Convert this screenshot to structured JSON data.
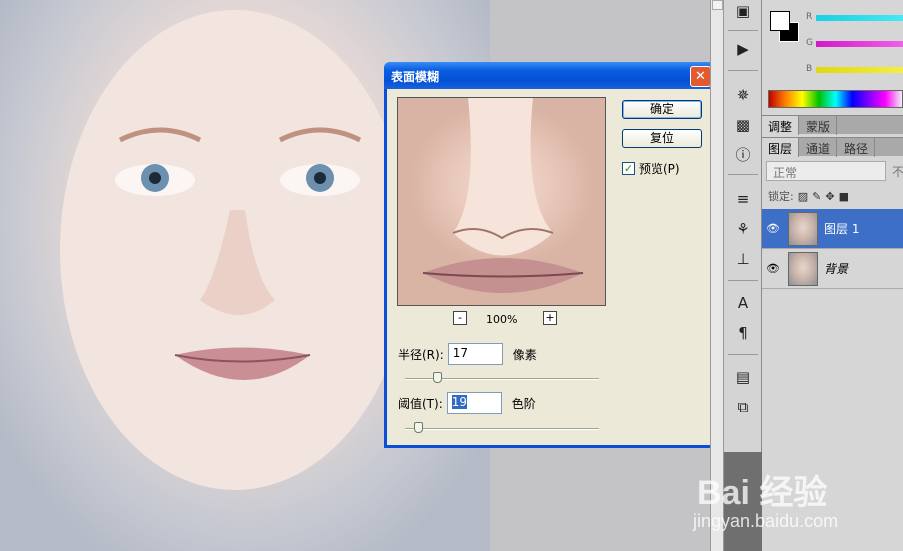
{
  "dialog": {
    "title": "表面模糊",
    "close_label": "✕",
    "ok_label": "确定",
    "reset_label": "复位",
    "preview_label": "预览(P)",
    "preview_checked": true,
    "zoom_out_label": "-",
    "zoom_in_label": "+",
    "zoom": "100%",
    "radius": {
      "label": "半径(R):",
      "value": "17",
      "unit": "像素"
    },
    "threshold": {
      "label": "阈值(T):",
      "value": "19",
      "unit": "色阶"
    }
  },
  "colors": {
    "slider_labels": [
      "R",
      "G",
      "B"
    ],
    "r_color": "#22d0e0",
    "g_color": "#e030d0",
    "b_color": "#e8e020"
  },
  "panels": {
    "tabs_top": [
      "调整",
      "蒙版"
    ],
    "tabs_layers": [
      "图层",
      "通道",
      "路径"
    ],
    "blend_mode": "正常",
    "opacity_label": "不",
    "lock_label": "锁定:",
    "layers": [
      {
        "name": "图层 1",
        "selected": true
      },
      {
        "name": "背景",
        "selected": false
      }
    ]
  },
  "tools": [
    "history-icon",
    "actions-icon",
    "navigator-icon",
    "histogram-icon",
    "info-icon",
    "brushes-icon",
    "clone-source-icon",
    "tool-presets-icon",
    "character-icon",
    "paragraph-icon",
    "notes-icon",
    "layer-comps-icon"
  ],
  "watermark": {
    "brand": "Bai 经验",
    "url": "jingyan.baidu.com"
  }
}
